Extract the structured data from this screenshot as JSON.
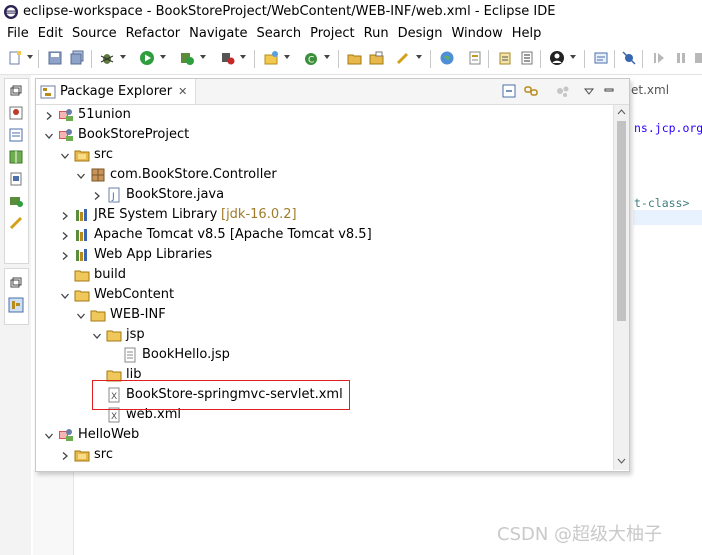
{
  "window": {
    "title": "eclipse-workspace - BookStoreProject/WebContent/WEB-INF/web.xml - Eclipse IDE"
  },
  "menu": [
    {
      "accel": "F",
      "rest": "ile"
    },
    {
      "accel": "E",
      "rest": "dit"
    },
    {
      "accel": "S",
      "rest": "ource"
    },
    {
      "accel": "",
      "pre": "Refac",
      "accel2": "t",
      "rest": "or"
    },
    {
      "accel": "N",
      "rest": "avigate"
    },
    {
      "pre": "Se",
      "accel": "a",
      "rest": "rch"
    },
    {
      "accel": "P",
      "rest": "roject"
    },
    {
      "accel": "R",
      "rest": "un"
    },
    {
      "accel": "D",
      "rest": "esign"
    },
    {
      "accel": "W",
      "rest": "indow"
    },
    {
      "accel": "H",
      "rest": "elp"
    }
  ],
  "menu_labels": [
    "File",
    "Edit",
    "Source",
    "Refactor",
    "Navigate",
    "Search",
    "Project",
    "Run",
    "Design",
    "Window",
    "Help"
  ],
  "package_explorer": {
    "tab_label": "Package Explorer",
    "close_glyph": "✕"
  },
  "tree": [
    {
      "label": "51union",
      "decoration": "",
      "depth": 0,
      "state": "collapsed",
      "icon": "project-icon"
    },
    {
      "label": "BookStoreProject",
      "decoration": "",
      "depth": 0,
      "state": "expanded",
      "icon": "project-icon"
    },
    {
      "label": "src",
      "decoration": "",
      "depth": 1,
      "state": "expanded",
      "icon": "source-folder-icon"
    },
    {
      "label": "com.BookStore.Controller",
      "decoration": "",
      "depth": 2,
      "state": "expanded",
      "icon": "package-icon"
    },
    {
      "label": "BookStore.java",
      "decoration": "",
      "depth": 3,
      "state": "collapsed",
      "icon": "java-file-icon"
    },
    {
      "label": "JRE System Library",
      "decoration": "[jdk-16.0.2]",
      "depth": 1,
      "state": "collapsed",
      "icon": "library-icon"
    },
    {
      "label": "Apache Tomcat v8.5 [Apache Tomcat v8.5]",
      "decoration": "",
      "depth": 1,
      "state": "collapsed",
      "icon": "library-icon"
    },
    {
      "label": "Web App Libraries",
      "decoration": "",
      "depth": 1,
      "state": "collapsed",
      "icon": "library-icon"
    },
    {
      "label": "build",
      "decoration": "",
      "depth": 1,
      "state": "none",
      "icon": "folder-icon"
    },
    {
      "label": "WebContent",
      "decoration": "",
      "depth": 1,
      "state": "expanded",
      "icon": "folder-icon"
    },
    {
      "label": "WEB-INF",
      "decoration": "",
      "depth": 2,
      "state": "expanded",
      "icon": "folder-icon"
    },
    {
      "label": "jsp",
      "decoration": "",
      "depth": 3,
      "state": "expanded",
      "icon": "folder-icon"
    },
    {
      "label": "BookHello.jsp",
      "decoration": "",
      "depth": 4,
      "state": "none",
      "icon": "jsp-file-icon"
    },
    {
      "label": "lib",
      "decoration": "",
      "depth": 3,
      "state": "none",
      "icon": "folder-icon"
    },
    {
      "label": "BookStore-springmvc-servlet.xml",
      "decoration": "",
      "depth": 3,
      "state": "none",
      "icon": "xml-file-icon",
      "highlighted": true
    },
    {
      "label": "web.xml",
      "decoration": "",
      "depth": 3,
      "state": "none",
      "icon": "xml-file-icon"
    },
    {
      "label": "HelloWeb",
      "decoration": "",
      "depth": 0,
      "state": "expanded",
      "icon": "project-icon"
    },
    {
      "label": "src",
      "decoration": "",
      "depth": 1,
      "state": "collapsed",
      "icon": "source-folder-icon"
    }
  ],
  "editor": {
    "tab_label": "et.xml",
    "lines": [
      {
        "text": "ns.jcp.org",
        "color": "#2a00ff"
      },
      {
        "text": "t-class>",
        "color": "#3f7f7f"
      }
    ]
  },
  "watermark": "CSDN @超级大柚子",
  "colors": {
    "highlight_box": "#e02020",
    "decoration": "#a07c2a"
  }
}
